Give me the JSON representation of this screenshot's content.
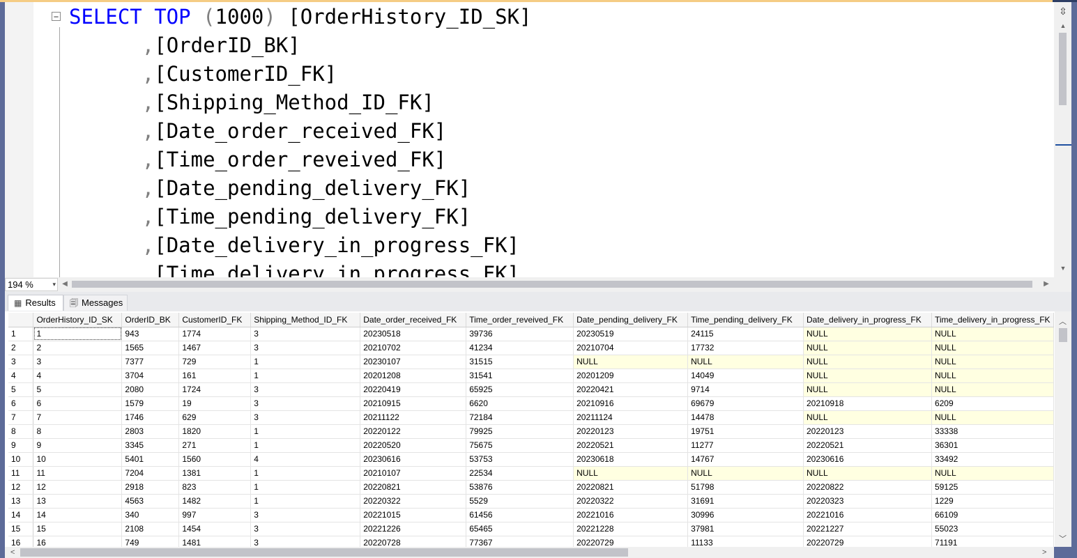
{
  "editor": {
    "collapse_glyph": "−",
    "lines": [
      {
        "segments": [
          {
            "text": "SELECT ",
            "cls": "kw"
          },
          {
            "text": "TOP ",
            "cls": "kw"
          },
          {
            "text": "(",
            "cls": "gr"
          },
          {
            "text": "1000",
            "cls": ""
          },
          {
            "text": ") ",
            "cls": "gr"
          },
          {
            "text": "[OrderHistory_ID_SK]",
            "cls": ""
          }
        ]
      },
      {
        "segments": [
          {
            "text": "      ",
            "cls": ""
          },
          {
            "text": ",",
            "cls": "gr"
          },
          {
            "text": "[OrderID_BK]",
            "cls": ""
          }
        ]
      },
      {
        "segments": [
          {
            "text": "      ",
            "cls": ""
          },
          {
            "text": ",",
            "cls": "gr"
          },
          {
            "text": "[CustomerID_FK]",
            "cls": ""
          }
        ]
      },
      {
        "segments": [
          {
            "text": "      ",
            "cls": ""
          },
          {
            "text": ",",
            "cls": "gr"
          },
          {
            "text": "[Shipping_Method_ID_FK]",
            "cls": ""
          }
        ]
      },
      {
        "segments": [
          {
            "text": "      ",
            "cls": ""
          },
          {
            "text": ",",
            "cls": "gr"
          },
          {
            "text": "[Date_order_received_FK]",
            "cls": ""
          }
        ]
      },
      {
        "segments": [
          {
            "text": "      ",
            "cls": ""
          },
          {
            "text": ",",
            "cls": "gr"
          },
          {
            "text": "[Time_order_reveived_FK]",
            "cls": ""
          }
        ]
      },
      {
        "segments": [
          {
            "text": "      ",
            "cls": ""
          },
          {
            "text": ",",
            "cls": "gr"
          },
          {
            "text": "[Date_pending_delivery_FK]",
            "cls": ""
          }
        ]
      },
      {
        "segments": [
          {
            "text": "      ",
            "cls": ""
          },
          {
            "text": ",",
            "cls": "gr"
          },
          {
            "text": "[Time_pending_delivery_FK]",
            "cls": ""
          }
        ]
      },
      {
        "segments": [
          {
            "text": "      ",
            "cls": ""
          },
          {
            "text": ",",
            "cls": "gr"
          },
          {
            "text": "[Date_delivery_in_progress_FK]",
            "cls": ""
          }
        ]
      },
      {
        "segments": [
          {
            "text": "      ",
            "cls": ""
          },
          {
            "text": ",",
            "cls": "gr"
          },
          {
            "text": "[Time_delivery_in_progress_FK]",
            "cls": ""
          }
        ]
      }
    ]
  },
  "zoom": {
    "value": "194 %",
    "arrow": "▾"
  },
  "scroll_glyphs": {
    "up": "▲",
    "down": "▼",
    "left": "◀",
    "right": "▶",
    "grid_up": "︿",
    "grid_down": "﹀",
    "grid_left": "<",
    "grid_right": ">",
    "split": "⇳"
  },
  "tabs": [
    {
      "label": "Results",
      "icon": "grid-icon",
      "glyph": "▦"
    },
    {
      "label": "Messages",
      "icon": "messages-icon",
      "glyph": "🗐"
    }
  ],
  "results": {
    "columns": [
      "",
      "OrderHistory_ID_SK",
      "OrderID_BK",
      "CustomerID_FK",
      "Shipping_Method_ID_FK",
      "Date_order_received_FK",
      "Time_order_reveived_FK",
      "Date_pending_delivery_FK",
      "Time_pending_delivery_FK",
      "Date_delivery_in_progress_FK",
      "Time_delivery_in_progress_FK"
    ],
    "rows": [
      [
        "1",
        "1",
        "943",
        "1774",
        "3",
        "20230518",
        "39736",
        "20230519",
        "24115",
        "NULL",
        "NULL"
      ],
      [
        "2",
        "2",
        "1565",
        "1467",
        "3",
        "20210702",
        "41234",
        "20210704",
        "17732",
        "NULL",
        "NULL"
      ],
      [
        "3",
        "3",
        "7377",
        "729",
        "1",
        "20230107",
        "31515",
        "NULL",
        "NULL",
        "NULL",
        "NULL"
      ],
      [
        "4",
        "4",
        "3704",
        "161",
        "1",
        "20201208",
        "31541",
        "20201209",
        "14049",
        "NULL",
        "NULL"
      ],
      [
        "5",
        "5",
        "2080",
        "1724",
        "3",
        "20220419",
        "65925",
        "20220421",
        "9714",
        "NULL",
        "NULL"
      ],
      [
        "6",
        "6",
        "1579",
        "19",
        "3",
        "20210915",
        "6620",
        "20210916",
        "69679",
        "20210918",
        "6209"
      ],
      [
        "7",
        "7",
        "1746",
        "629",
        "3",
        "20211122",
        "72184",
        "20211124",
        "14478",
        "NULL",
        "NULL"
      ],
      [
        "8",
        "8",
        "2803",
        "1820",
        "1",
        "20220122",
        "79925",
        "20220123",
        "19751",
        "20220123",
        "33338"
      ],
      [
        "9",
        "9",
        "3345",
        "271",
        "1",
        "20220520",
        "75675",
        "20220521",
        "11277",
        "20220521",
        "36301"
      ],
      [
        "10",
        "10",
        "5401",
        "1560",
        "4",
        "20230616",
        "53753",
        "20230618",
        "14767",
        "20230616",
        "33492"
      ],
      [
        "11",
        "11",
        "7204",
        "1381",
        "1",
        "20210107",
        "22534",
        "NULL",
        "NULL",
        "NULL",
        "NULL"
      ],
      [
        "12",
        "12",
        "2918",
        "823",
        "1",
        "20220821",
        "53876",
        "20220821",
        "51798",
        "20220822",
        "59125"
      ],
      [
        "13",
        "13",
        "4563",
        "1482",
        "1",
        "20220322",
        "5529",
        "20220322",
        "31691",
        "20220323",
        "1229"
      ],
      [
        "14",
        "14",
        "340",
        "997",
        "3",
        "20221015",
        "61456",
        "20221016",
        "30996",
        "20221016",
        "66109"
      ],
      [
        "15",
        "15",
        "2108",
        "1454",
        "3",
        "20221226",
        "65465",
        "20221228",
        "37981",
        "20221227",
        "55023"
      ],
      [
        "16",
        "16",
        "749",
        "1481",
        "3",
        "20220728",
        "77367",
        "20220729",
        "11133",
        "20220729",
        "71191"
      ]
    ]
  }
}
